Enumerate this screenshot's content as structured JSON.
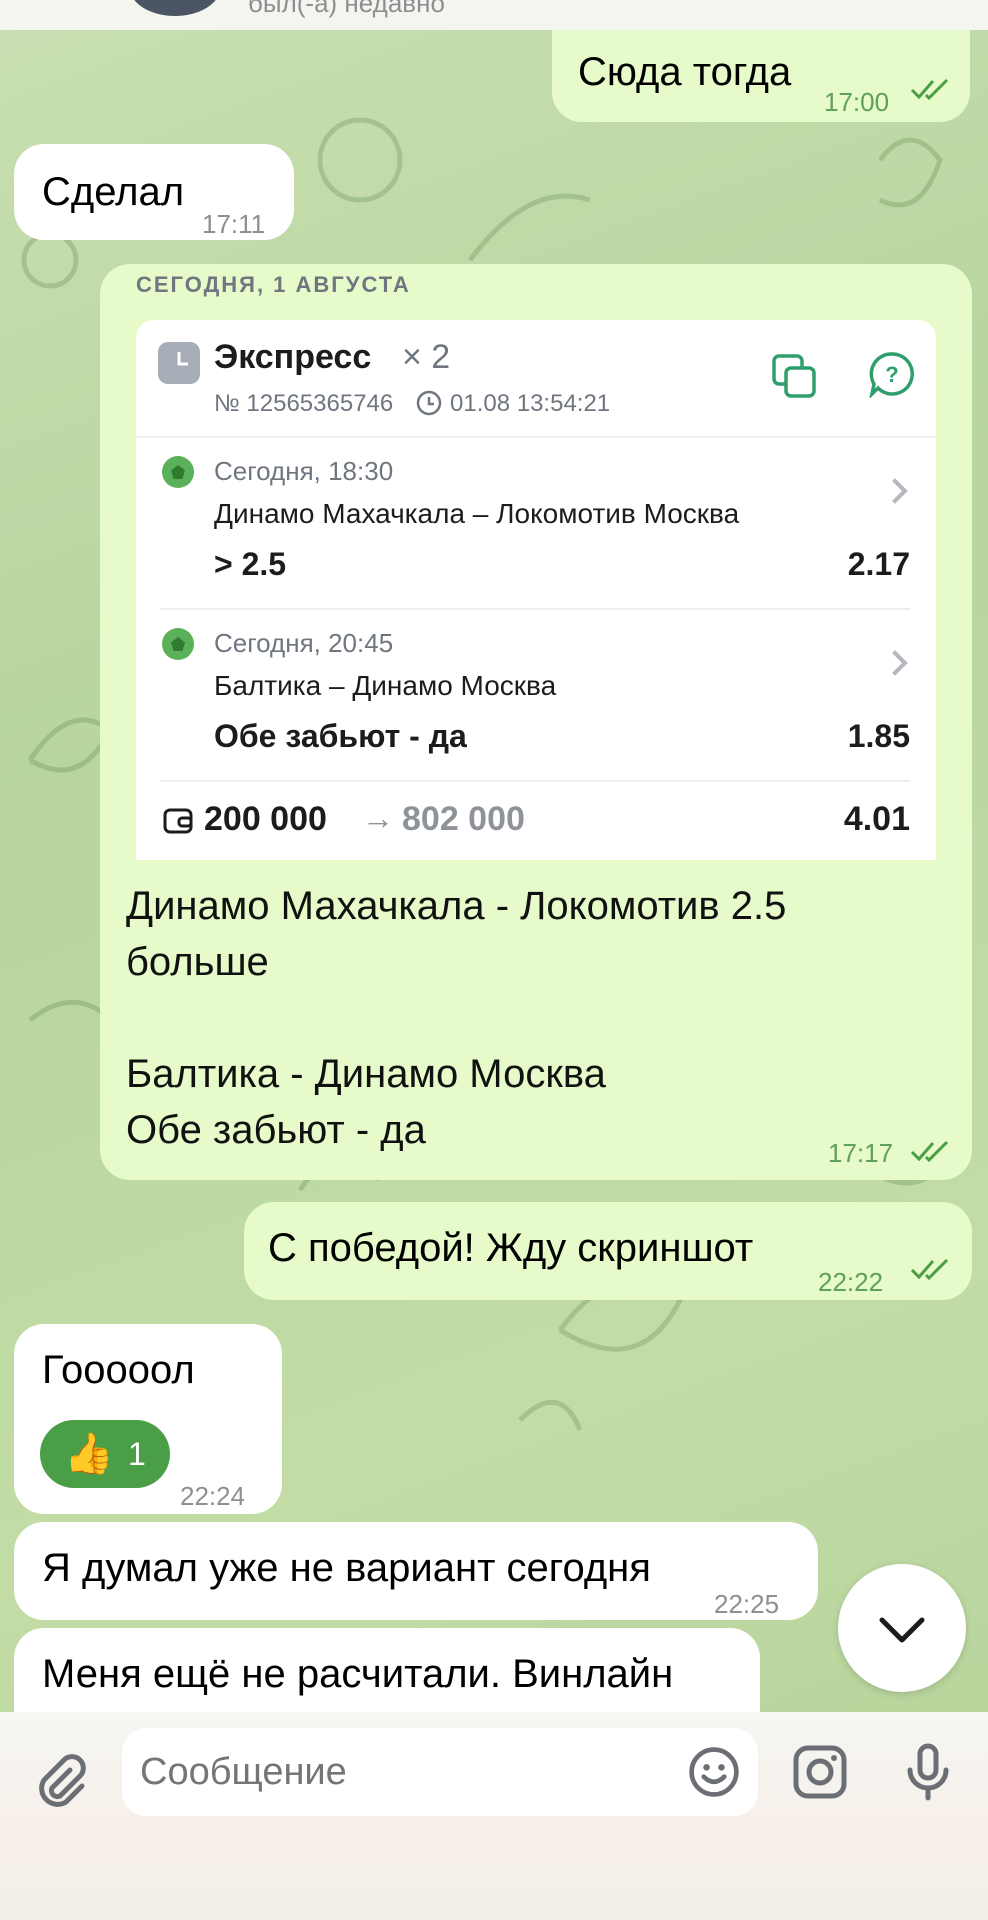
{
  "header": {
    "status": "был(-а) недавно"
  },
  "messages": {
    "m1": {
      "text": "Сюда тогда",
      "time": "17:00"
    },
    "m2": {
      "text": "Сделал",
      "time": "17:11"
    },
    "bet": {
      "date_header": "СЕГОДНЯ, 1 АВГУСТА",
      "title": "Экспресс",
      "multiplier": "× 2",
      "number": "№ 12565365746",
      "datetime": "01.08 13:54:21",
      "events": [
        {
          "when": "Сегодня, 18:30",
          "match": "Динамо Махачкала – Локомотив Москва",
          "pick": "> 2.5",
          "odds": "2.17"
        },
        {
          "when": "Сегодня, 20:45",
          "match": "Балтика – Динамо Москва",
          "pick": "Обе забьют - да",
          "odds": "1.85"
        }
      ],
      "stake": "200 000",
      "arrow": "→",
      "payout": "802 000",
      "total_odds": "4.01"
    },
    "m3": {
      "line1": "Динамо Махачкала - Локомотив 2.5",
      "line2": "больше",
      "line3": "Балтика - Динамо Москва",
      "line4": "Обе забьют - да",
      "time": "17:17"
    },
    "m4": {
      "text": "С победой! Жду скриншот",
      "time": "22:22"
    },
    "m5": {
      "text": "Гооооол",
      "reaction_count": "1",
      "time": "22:24"
    },
    "m6": {
      "text": "Я думал уже не вариант сегодня",
      "time": "22:25"
    },
    "m7": {
      "text": "Меня ещё не расчитали. Винлайн"
    }
  },
  "composer": {
    "placeholder": "Сообщение"
  },
  "colors": {
    "outgoing": "#e6fbc9",
    "incoming": "#ffffff",
    "accent": "#2e9e6a",
    "reaction": "#4a9e45"
  },
  "icons": [
    "paperclip-icon",
    "emoji-icon",
    "camera-icon",
    "microphone-icon",
    "chevron-down-icon",
    "copy-icon",
    "help-icon",
    "clock-icon",
    "wallet-icon",
    "football-icon",
    "double-check-icon"
  ]
}
